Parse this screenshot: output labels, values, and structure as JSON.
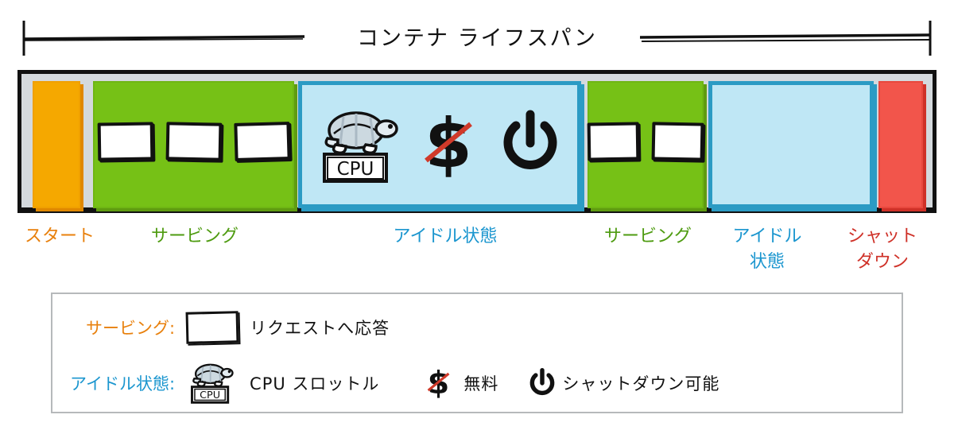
{
  "title": "コンテナ ライフスパン",
  "timeline": {
    "segments": [
      {
        "id": "start",
        "kind": "start",
        "label": "スタート",
        "color": "#f5a800",
        "label_color": "#e8800c",
        "requests": 0
      },
      {
        "id": "serving-1",
        "kind": "serving",
        "label": "サービング",
        "color": "#76c116",
        "label_color": "#4e9b10",
        "requests": 3
      },
      {
        "id": "idle-1",
        "kind": "idle",
        "label": "アイドル状態",
        "color": "#bfe7f5",
        "label_color": "#1b96cf",
        "requests": 0,
        "icons": [
          "cpu-turtle-icon",
          "no-cost-icon",
          "power-icon"
        ]
      },
      {
        "id": "serving-2",
        "kind": "serving",
        "label": "サービング",
        "color": "#76c116",
        "label_color": "#4e9b10",
        "requests": 2
      },
      {
        "id": "idle-2",
        "kind": "idle",
        "label": "アイドル\n状態",
        "color": "#bfe7f5",
        "label_color": "#1b96cf",
        "requests": 0,
        "icons": []
      },
      {
        "id": "shutdown",
        "kind": "shutdown",
        "label": "シャット\nダウン",
        "color": "#f2554b",
        "label_color": "#cf3128",
        "requests": 0
      }
    ]
  },
  "legend": {
    "rows": [
      {
        "key": "サービング:",
        "key_color": "#e8800c",
        "items": [
          {
            "icon": "request-box-icon",
            "text": "リクエストへ応答"
          }
        ]
      },
      {
        "key": "アイドル状態:",
        "key_color": "#1b96cf",
        "items": [
          {
            "icon": "cpu-turtle-icon",
            "text": "CPU スロットル"
          },
          {
            "icon": "no-cost-icon",
            "text": "無料"
          },
          {
            "icon": "power-icon",
            "text": "シャットダウン可能"
          }
        ]
      }
    ]
  },
  "colors": {
    "start": "#f5a800",
    "serving": "#76c116",
    "idle": "#bfe7f5",
    "idle_border": "#2b9bc4",
    "shutdown": "#f2554b",
    "track": "#d4d9dd",
    "frame": "#111111",
    "slash": "#d03a2a"
  }
}
